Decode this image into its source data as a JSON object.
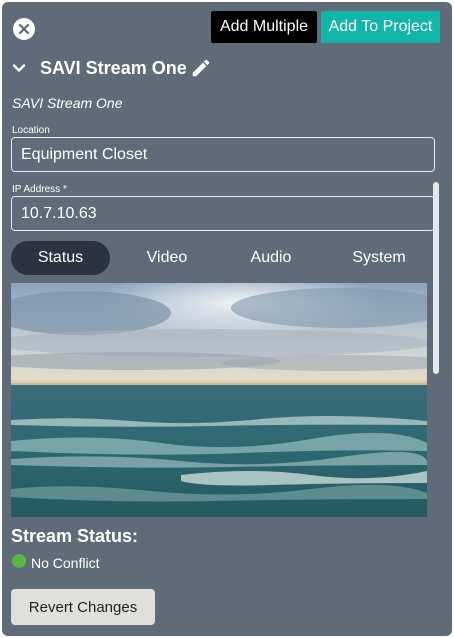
{
  "toolbar": {
    "close_icon": "close-icon",
    "add_multiple_label": "Add Multiple",
    "add_to_project_label": "Add To Project",
    "colors": {
      "add_multiple_bg": "#000000",
      "add_to_project_bg": "#13b5a8"
    }
  },
  "device": {
    "title": "SAVI Stream One",
    "subtitle": "SAVI Stream One",
    "collapse_icon": "chevron-down-icon",
    "edit_icon": "pencil-icon"
  },
  "form": {
    "location": {
      "label": "Location",
      "value": "Equipment Closet"
    },
    "ip_address": {
      "label": "IP Address *",
      "value": "10.7.10.63"
    }
  },
  "tabs": [
    {
      "label": "Status",
      "active": true
    },
    {
      "label": "Video",
      "active": false
    },
    {
      "label": "Audio",
      "active": false
    },
    {
      "label": "System",
      "active": false
    }
  ],
  "status": {
    "heading": "Stream Status:",
    "text": "No Conflict",
    "dot_color": "#5cb346"
  },
  "actions": {
    "revert_label": "Revert Changes"
  },
  "theme": {
    "panel_bg": "#5f6b78",
    "active_tab_bg": "#2b3340"
  }
}
